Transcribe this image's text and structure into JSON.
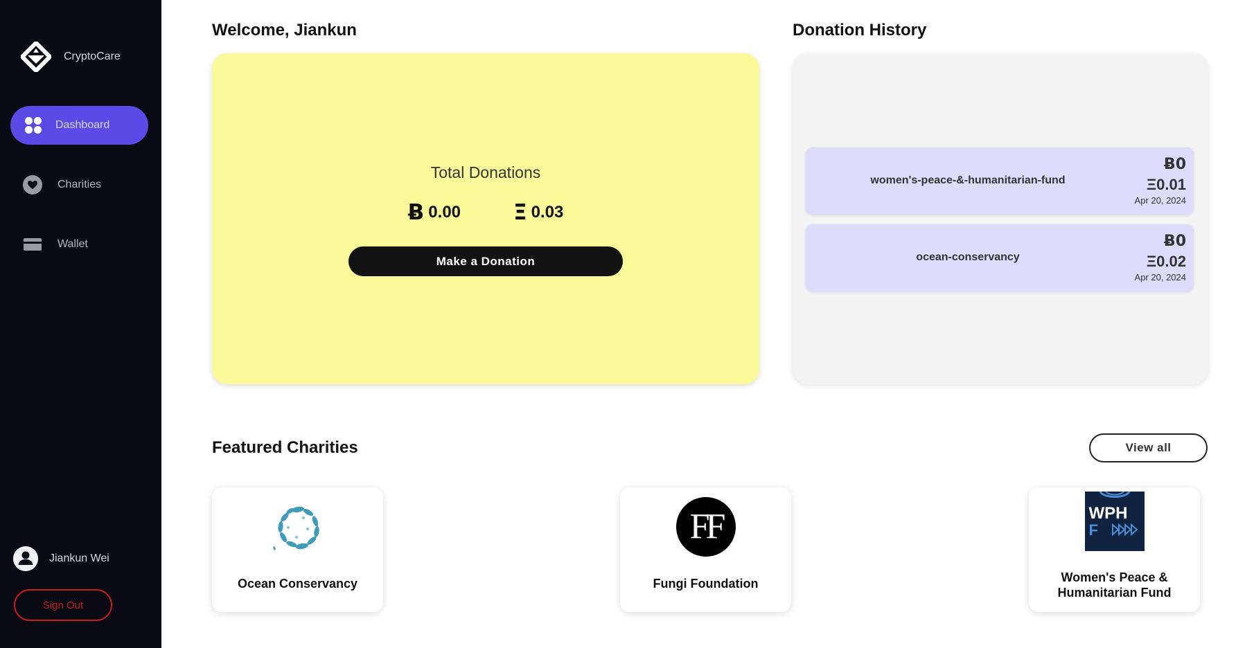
{
  "app": {
    "name": "CryptoCare"
  },
  "sidebar": {
    "items": [
      {
        "label": "Dashboard",
        "icon": "grid-icon",
        "active": true
      },
      {
        "label": "Charities",
        "icon": "heart-icon",
        "active": false
      },
      {
        "label": "Wallet",
        "icon": "wallet-icon",
        "active": false
      }
    ],
    "user": {
      "name": "Jiankun Wei",
      "icon": "user-icon"
    },
    "signout_label": "Sign Out"
  },
  "main": {
    "welcome": "Welcome, Jiankun",
    "total": {
      "label": "Total Donations",
      "btc_symbol": "Ƀ",
      "btc_value": "0.00",
      "eth_symbol": "Ξ",
      "eth_value": "0.03",
      "button_label": "Make a Donation"
    },
    "history": {
      "title": "Donation History",
      "items": [
        {
          "name": "women's-peace-&-humanitarian-fund",
          "btc": "Ƀ0",
          "eth": "Ξ0.01",
          "date": "Apr 20, 2024"
        },
        {
          "name": "ocean-conservancy",
          "btc": "Ƀ0",
          "eth": "Ξ0.02",
          "date": "Apr 20, 2024"
        }
      ]
    },
    "featured": {
      "title": "Featured Charities",
      "view_all_label": "View all",
      "charities": [
        {
          "name": "Ocean Conservancy",
          "logo": "ocean-conservancy-logo"
        },
        {
          "name": "Fungi Foundation",
          "logo": "fungi-foundation-logo",
          "logo_text": "FF"
        },
        {
          "name": "Women's Peace & Humanitarian Fund",
          "logo": "wphf-logo",
          "logo_text_top": "WPH",
          "logo_text_bottom": "F"
        }
      ]
    }
  },
  "colors": {
    "sidebar_bg": "#0a0a14",
    "accent": "#5a4ae6",
    "total_card": "#fafa9a",
    "history_item": "#dcdcfc",
    "signout": "#c81e1e"
  }
}
